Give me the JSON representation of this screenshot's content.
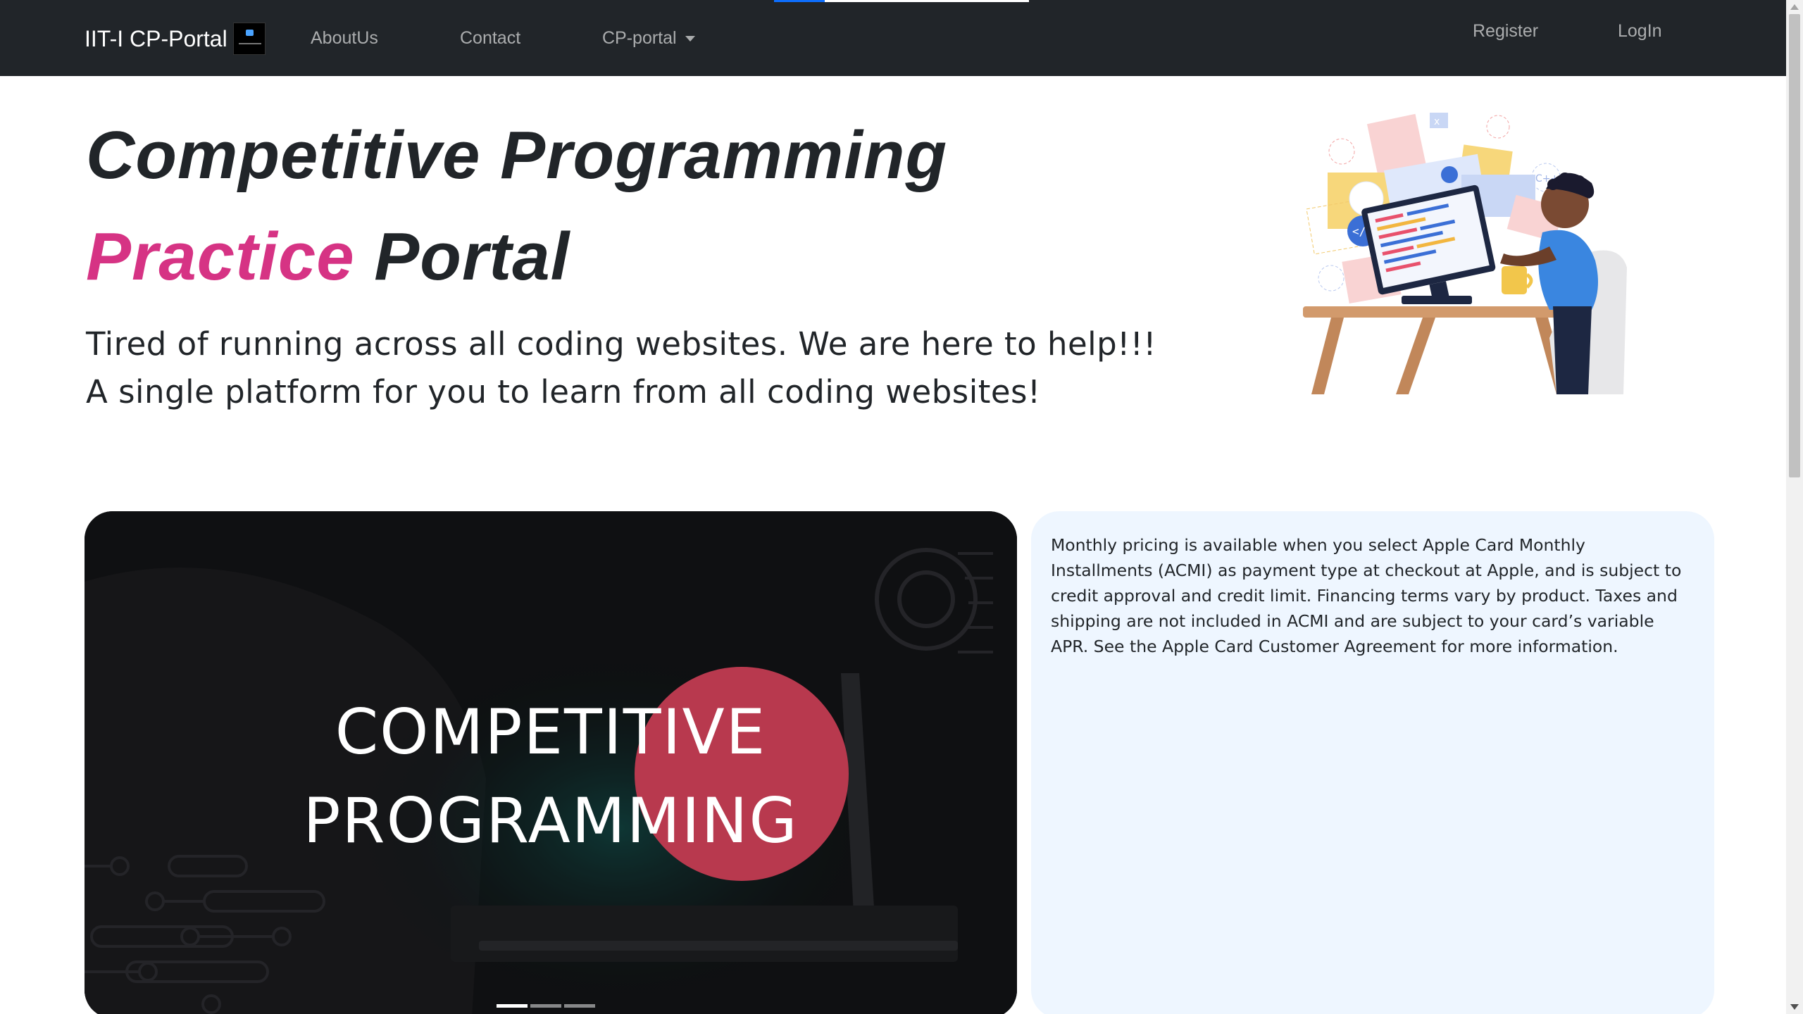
{
  "navbar": {
    "brand": "IIT-I CP-Portal",
    "links": {
      "about": "AboutUs",
      "contact": "Contact",
      "cp_portal": "CP-portal",
      "register": "Register",
      "login": "LogIn"
    }
  },
  "hero": {
    "title_line1": "Competitive Programming",
    "title_accent": "Practice",
    "title_rest": "Portal",
    "subtitle_line1": "Tired of running across all coding websites. We are here to help!!!",
    "subtitle_line2": "A single platform for you to learn from all coding websites!",
    "illustration_icon": "developer-at-desk-illustration"
  },
  "carousel": {
    "slide_title_line1": "COMPETITIVE",
    "slide_title_line2": "PROGRAMMING",
    "slide_count": 3,
    "active_slide": 1
  },
  "info_card": {
    "text": "Monthly pricing is available when you select Apple Card Monthly Installments (ACMI) as payment type at checkout at Apple, and is subject to credit approval and credit limit. Financing terms vary by product. Taxes and shipping are not included in ACMI and are subject to your card’s variable APR. See the Apple Card Customer Agreement for more information."
  },
  "colors": {
    "navbar_bg": "#212529",
    "accent_pink": "#d63384",
    "circle_red": "#e14660",
    "card_bg": "#eef6ff"
  }
}
